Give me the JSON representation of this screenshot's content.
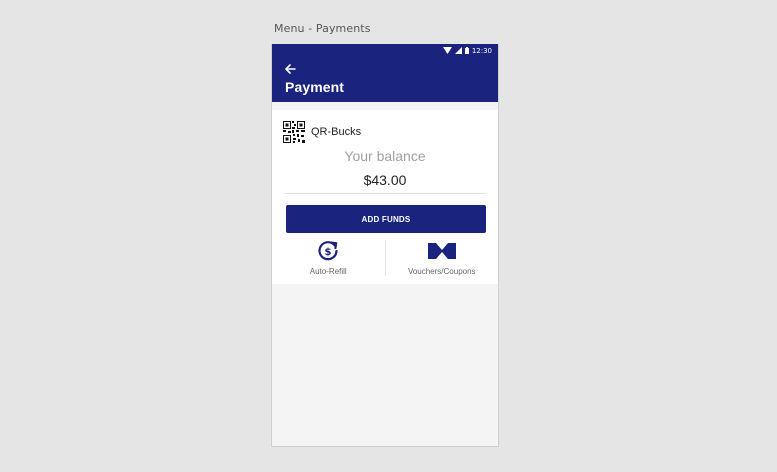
{
  "canvas": {
    "caption": "Menu - Payments"
  },
  "status_bar": {
    "time": "12:30",
    "icons": [
      "wifi-icon",
      "signal-icon",
      "battery-icon"
    ]
  },
  "app_bar": {
    "back_icon": "arrow-left-icon",
    "title": "Payment"
  },
  "wallet": {
    "icon": "qr-code-icon",
    "name": "QR-Bucks",
    "balance_label": "Your balance",
    "balance_value": "$43.00",
    "add_funds_label": "ADD FUNDS"
  },
  "actions": [
    {
      "icon": "auto-refill-icon",
      "label": "Auto-Refill"
    },
    {
      "icon": "voucher-icon",
      "label": "Vouchers/Coupons"
    }
  ],
  "colors": {
    "primary": "#1a237e",
    "background": "#f4f4f4",
    "card": "#ffffff",
    "canvas": "#e5e5e5"
  }
}
